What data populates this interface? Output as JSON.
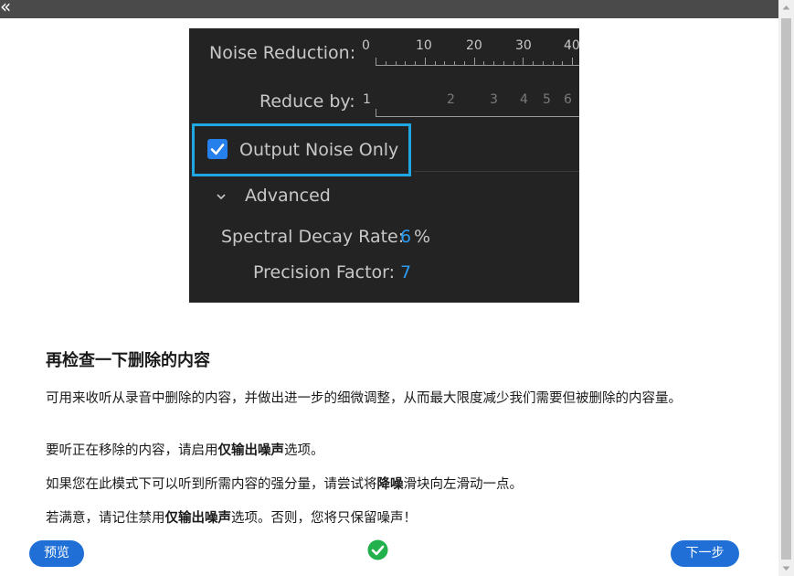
{
  "toolbar": {
    "collapse_glyph": "«"
  },
  "screenshot": {
    "noise_reduction_label": "Noise Reduction:",
    "noise_reduction_ticks": [
      "0",
      "10",
      "20",
      "30",
      "40"
    ],
    "reduce_by_label": "Reduce by:",
    "reduce_by_ticks": [
      "1",
      "2",
      "3",
      "4",
      "5",
      "6"
    ],
    "output_noise_only_label": "Output Noise Only",
    "output_noise_only_checked": true,
    "advanced_label": "Advanced",
    "spectral_decay_label": "Spectral Decay Rate:",
    "spectral_decay_value": "6",
    "spectral_decay_unit": "%",
    "precision_factor_label": "Precision Factor:",
    "precision_factor_value": "7",
    "highlight_color": "#1ea7e0",
    "value_color": "#2d9cf0"
  },
  "article": {
    "heading": "再检查一下删除的内容",
    "p1": "可用来收听从录音中删除的内容，并做出进一步的细微调整，从而最大限度减少我们需要但被删除的内容量。",
    "p2_pre": "要听正在移除的内容，请启用",
    "p2_bold": "仅输出噪声",
    "p2_post": "选项。",
    "p3_pre": "如果您在此模式下可以听到所需内容的强分量，请尝试将",
    "p3_bold": "降噪",
    "p3_post": "滑块向左滑动一点。",
    "p4_pre": "若满意，请记住禁用",
    "p4_bold": "仅输出噪声",
    "p4_post": "选项。否则，您将只保留噪声！"
  },
  "footer": {
    "preview_label": "预览",
    "next_label": "下一步",
    "done_icon": "check-circle-icon",
    "accent_color": "#1f6fd6",
    "done_color": "#22b14c"
  }
}
